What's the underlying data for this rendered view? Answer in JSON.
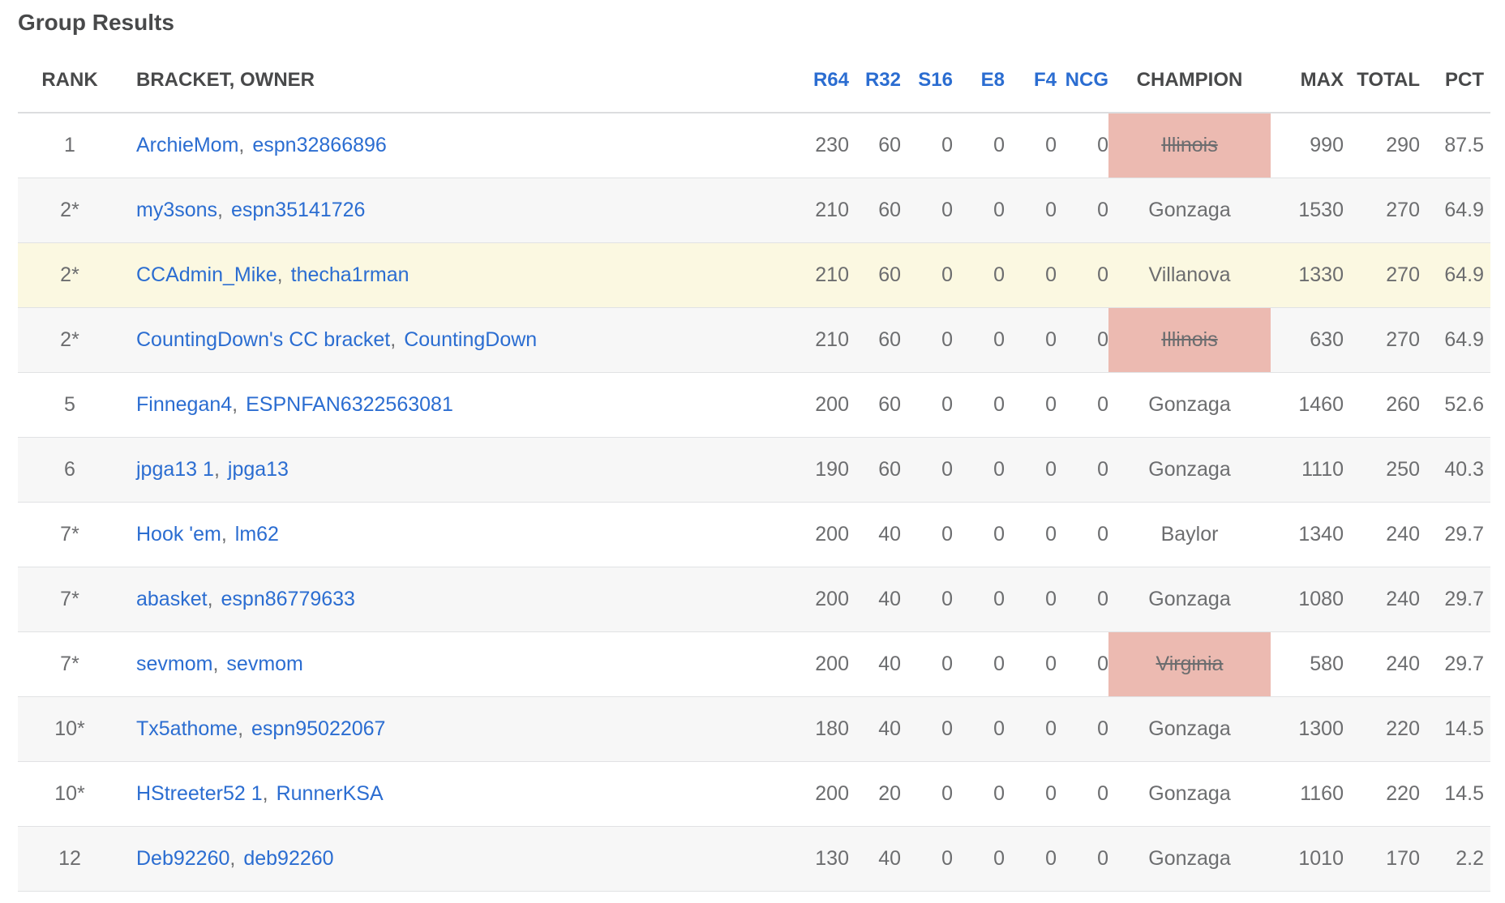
{
  "title": "Group Results",
  "headers": {
    "rank": "RANK",
    "bracket": "BRACKET, OWNER",
    "r64": "R64",
    "r32": "R32",
    "s16": "S16",
    "e8": "E8",
    "f4": "F4",
    "ncg": "NCG",
    "champion": "CHAMPION",
    "max": "MAX",
    "total": "TOTAL",
    "pct": "PCT"
  },
  "colors": {
    "link": "#2b6dd1",
    "eliminated": "#ecbab1",
    "highlight": "#fbf8e1",
    "alt_row": "#f7f7f7"
  },
  "rows": [
    {
      "rank": "1",
      "bracket": "ArchieMom",
      "owner": "espn32866896",
      "r64": "230",
      "r32": "60",
      "s16": "0",
      "e8": "0",
      "f4": "0",
      "ncg": "0",
      "champion": "Illinois",
      "eliminated": true,
      "max": "990",
      "total": "290",
      "pct": "87.5"
    },
    {
      "rank": "2*",
      "bracket": "my3sons",
      "owner": "espn35141726",
      "r64": "210",
      "r32": "60",
      "s16": "0",
      "e8": "0",
      "f4": "0",
      "ncg": "0",
      "champion": "Gonzaga",
      "eliminated": false,
      "max": "1530",
      "total": "270",
      "pct": "64.9"
    },
    {
      "rank": "2*",
      "bracket": "CCAdmin_Mike",
      "owner": "thecha1rman",
      "r64": "210",
      "r32": "60",
      "s16": "0",
      "e8": "0",
      "f4": "0",
      "ncg": "0",
      "champion": "Villanova",
      "eliminated": false,
      "highlight": true,
      "max": "1330",
      "total": "270",
      "pct": "64.9"
    },
    {
      "rank": "2*",
      "bracket": "CountingDown's CC bracket",
      "owner": "CountingDown",
      "r64": "210",
      "r32": "60",
      "s16": "0",
      "e8": "0",
      "f4": "0",
      "ncg": "0",
      "champion": "Illinois",
      "eliminated": true,
      "max": "630",
      "total": "270",
      "pct": "64.9"
    },
    {
      "rank": "5",
      "bracket": "Finnegan4",
      "owner": "ESPNFAN6322563081",
      "r64": "200",
      "r32": "60",
      "s16": "0",
      "e8": "0",
      "f4": "0",
      "ncg": "0",
      "champion": "Gonzaga",
      "eliminated": false,
      "max": "1460",
      "total": "260",
      "pct": "52.6"
    },
    {
      "rank": "6",
      "bracket": "jpga13 1",
      "owner": "jpga13",
      "r64": "190",
      "r32": "60",
      "s16": "0",
      "e8": "0",
      "f4": "0",
      "ncg": "0",
      "champion": "Gonzaga",
      "eliminated": false,
      "max": "1110",
      "total": "250",
      "pct": "40.3"
    },
    {
      "rank": "7*",
      "bracket": "Hook 'em",
      "owner": "lm62",
      "r64": "200",
      "r32": "40",
      "s16": "0",
      "e8": "0",
      "f4": "0",
      "ncg": "0",
      "champion": "Baylor",
      "eliminated": false,
      "max": "1340",
      "total": "240",
      "pct": "29.7"
    },
    {
      "rank": "7*",
      "bracket": "abasket",
      "owner": "espn86779633",
      "r64": "200",
      "r32": "40",
      "s16": "0",
      "e8": "0",
      "f4": "0",
      "ncg": "0",
      "champion": "Gonzaga",
      "eliminated": false,
      "max": "1080",
      "total": "240",
      "pct": "29.7"
    },
    {
      "rank": "7*",
      "bracket": "sevmom",
      "owner": "sevmom",
      "r64": "200",
      "r32": "40",
      "s16": "0",
      "e8": "0",
      "f4": "0",
      "ncg": "0",
      "champion": "Virginia",
      "eliminated": true,
      "max": "580",
      "total": "240",
      "pct": "29.7"
    },
    {
      "rank": "10*",
      "bracket": "Tx5athome",
      "owner": "espn95022067",
      "r64": "180",
      "r32": "40",
      "s16": "0",
      "e8": "0",
      "f4": "0",
      "ncg": "0",
      "champion": "Gonzaga",
      "eliminated": false,
      "max": "1300",
      "total": "220",
      "pct": "14.5"
    },
    {
      "rank": "10*",
      "bracket": "HStreeter52 1",
      "owner": "RunnerKSA",
      "r64": "200",
      "r32": "20",
      "s16": "0",
      "e8": "0",
      "f4": "0",
      "ncg": "0",
      "champion": "Gonzaga",
      "eliminated": false,
      "max": "1160",
      "total": "220",
      "pct": "14.5"
    },
    {
      "rank": "12",
      "bracket": "Deb92260",
      "owner": "deb92260",
      "r64": "130",
      "r32": "40",
      "s16": "0",
      "e8": "0",
      "f4": "0",
      "ncg": "0",
      "champion": "Gonzaga",
      "eliminated": false,
      "max": "1010",
      "total": "170",
      "pct": "2.2"
    }
  ]
}
